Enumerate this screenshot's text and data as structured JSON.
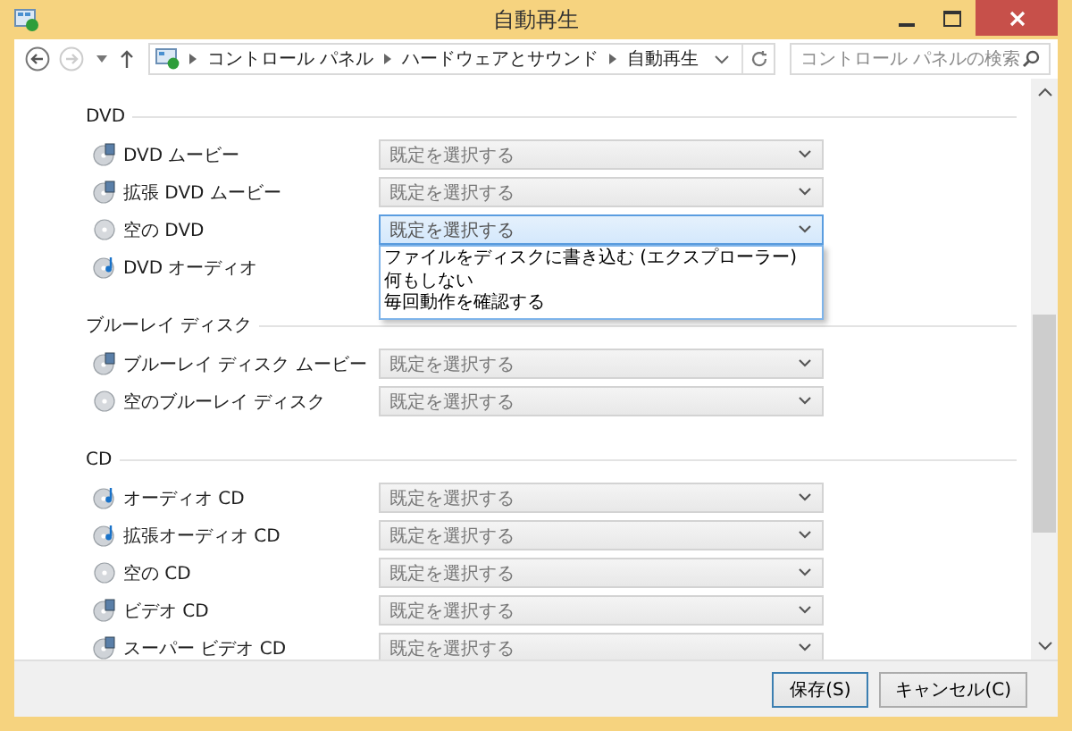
{
  "window": {
    "title": "自動再生"
  },
  "address_bar": {
    "path": [
      "コントロール パネル",
      "ハードウェアとサウンド",
      "自動再生"
    ]
  },
  "search": {
    "placeholder": "コントロール パネルの検索"
  },
  "sections": [
    {
      "title": "DVD",
      "items": [
        {
          "label": "DVD ムービー",
          "kind": "video",
          "value": "既定を選択する",
          "expanded": false
        },
        {
          "label": "拡張 DVD ムービー",
          "kind": "video",
          "value": "既定を選択する",
          "expanded": false
        },
        {
          "label": "空の DVD",
          "kind": "blank",
          "value": "既定を選択する",
          "expanded": true,
          "options": [
            "ファイルをディスクに書き込む (エクスプローラー)",
            "何もしない",
            "毎回動作を確認する"
          ]
        },
        {
          "label": "DVD オーディオ",
          "kind": "audio"
        }
      ]
    },
    {
      "title": "ブルーレイ ディスク",
      "items": [
        {
          "label": "ブルーレイ ディスク ムービー",
          "kind": "video",
          "value": "既定を選択する",
          "expanded": false
        },
        {
          "label": "空のブルーレイ ディスク",
          "kind": "blank",
          "value": "既定を選択する",
          "expanded": false
        }
      ]
    },
    {
      "title": "CD",
      "items": [
        {
          "label": "オーディオ CD",
          "kind": "audio",
          "value": "既定を選択する",
          "expanded": false
        },
        {
          "label": "拡張オーディオ CD",
          "kind": "audio",
          "value": "既定を選択する",
          "expanded": false
        },
        {
          "label": "空の CD",
          "kind": "blank",
          "value": "既定を選択する",
          "expanded": false
        },
        {
          "label": "ビデオ CD",
          "kind": "video",
          "value": "既定を選択する",
          "expanded": false
        },
        {
          "label": "スーパー ビデオ CD",
          "kind": "video",
          "value": "既定を選択する",
          "expanded": false
        }
      ]
    }
  ],
  "buttons": [
    {
      "label": "保存(S)",
      "default": true
    },
    {
      "label": "キャンセル(C)",
      "default": false
    }
  ]
}
